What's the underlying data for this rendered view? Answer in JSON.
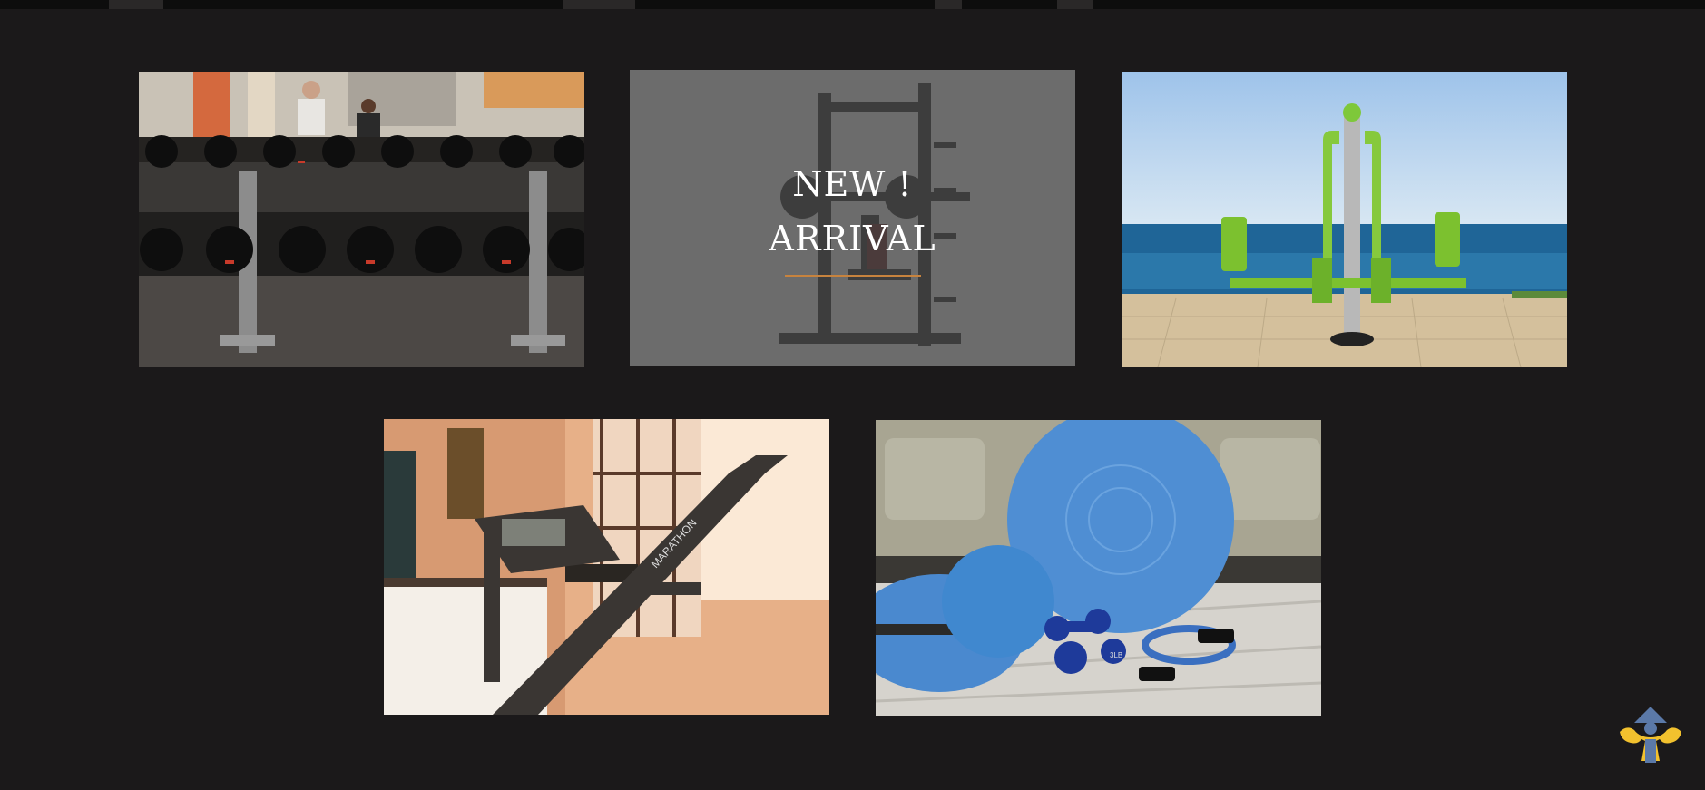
{
  "gallery": {
    "items": [
      {
        "subject": "dumbbell rack in gym"
      },
      {
        "subject": "squat rack machine",
        "overlay": {
          "line1": "NEW !",
          "line2": "ARRIVAL"
        }
      },
      {
        "subject": "outdoor fitness equipment by the sea"
      },
      {
        "subject": "home treadmill",
        "brand_text": "MARATHON"
      },
      {
        "subject": "exercise balls and dumbbells",
        "weight_label": "3LB"
      }
    ]
  },
  "colors": {
    "background": "#1b191a",
    "accent": "#c7833e",
    "fab_yellow": "#f2c12e",
    "fab_blue": "#5b79a8"
  },
  "floating_button": {
    "icon": "strongman-logo-icon"
  }
}
